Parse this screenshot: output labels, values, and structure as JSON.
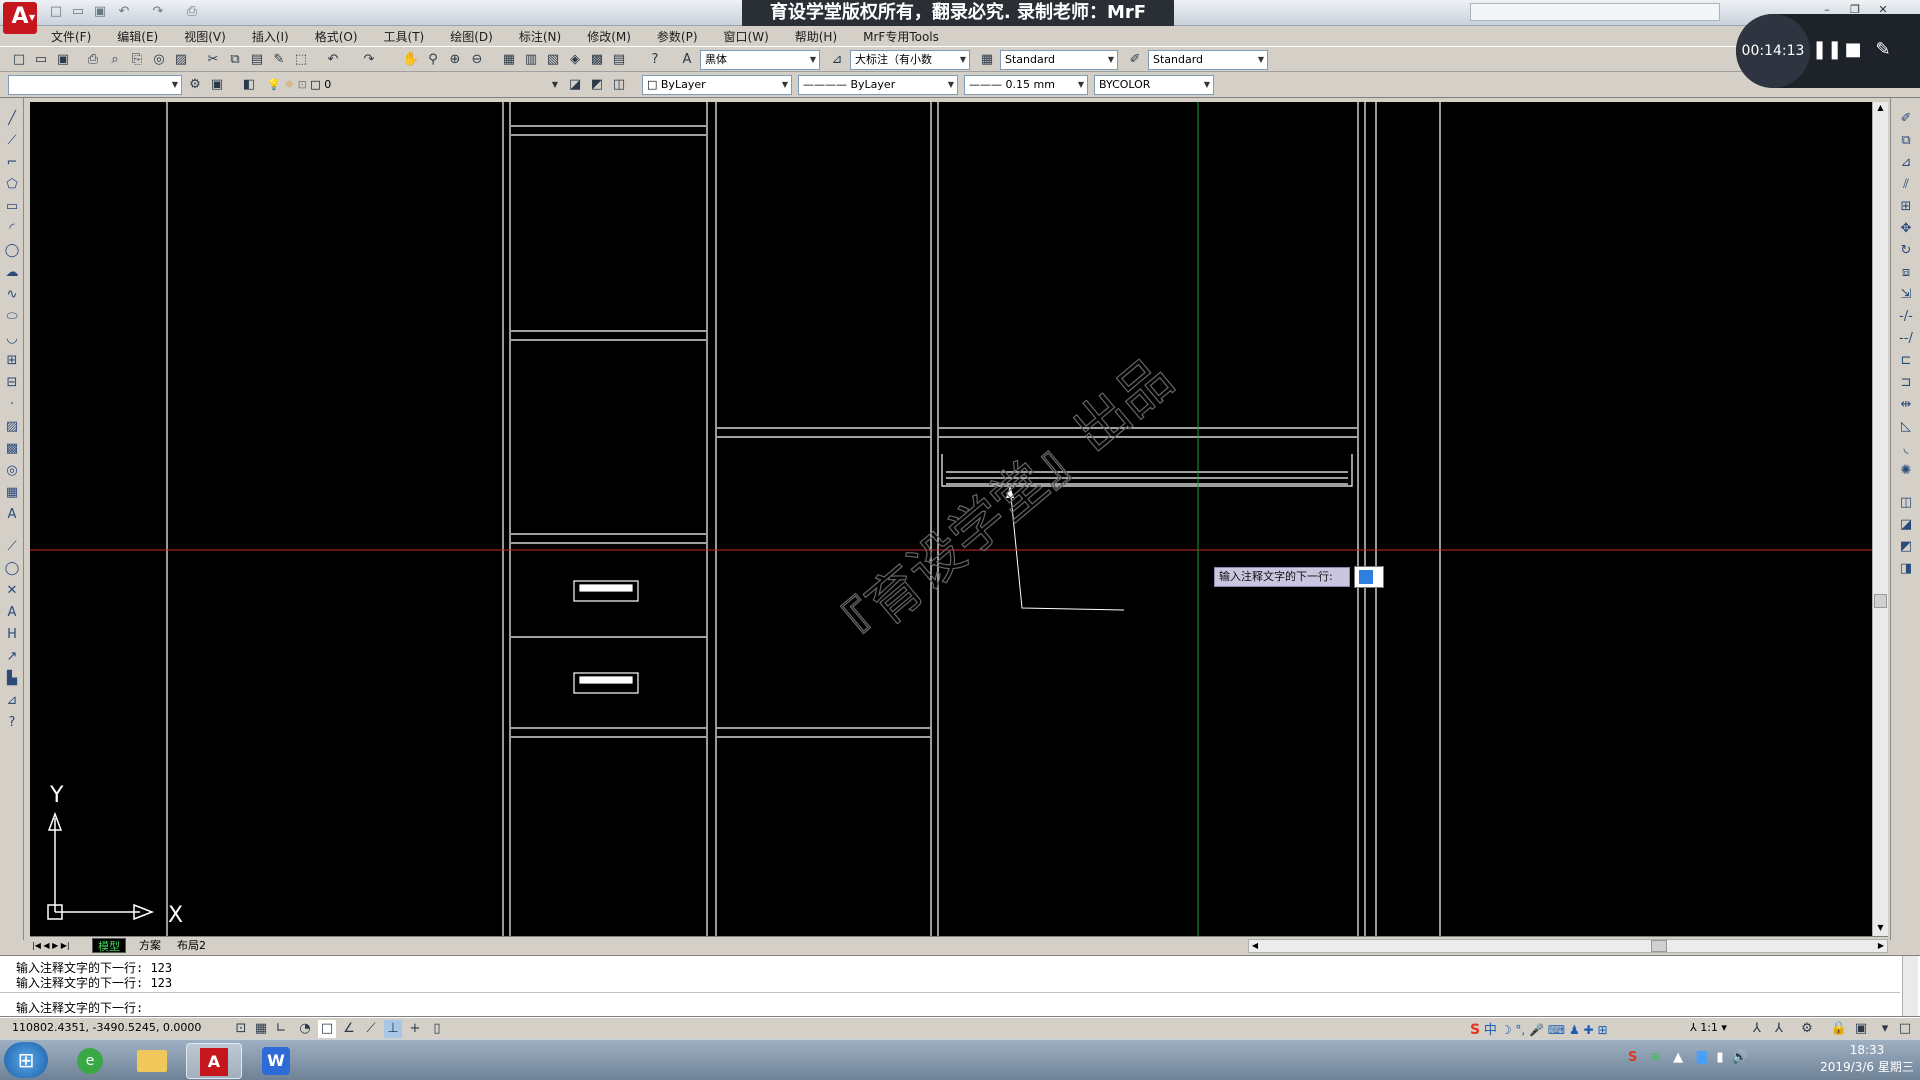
{
  "window": {
    "title": "育设学堂版权所有，翻录必究. 录制老师：MrF",
    "logo_text": "A"
  },
  "menu": [
    "文件(F)",
    "编辑(E)",
    "视图(V)",
    "插入(I)",
    "格式(O)",
    "工具(T)",
    "绘图(D)",
    "标注(N)",
    "修改(M)",
    "参数(P)",
    "窗口(W)",
    "帮助(H)",
    "MrF专用Tools"
  ],
  "toolbar1": {
    "font_combo": "黑体",
    "dim_style_combo": "大标注（有小数",
    "text_style_combo": "Standard",
    "table_style_combo": "Standard"
  },
  "toolbar2": {
    "layer_value": "0",
    "color_combo": "ByLayer",
    "linetype_combo": "ByLayer",
    "lineweight_combo": "0.15 mm",
    "plotstyle_combo": "BYCOLOR"
  },
  "recorder": {
    "time": "00:14:13"
  },
  "canvas": {
    "watermark": "『育设学堂』出品",
    "ucs_y": "Y",
    "ucs_x": "X",
    "dynamic_prompt": "输入注释文字的下一行:"
  },
  "tabs": [
    "模型",
    "方案",
    "布局2"
  ],
  "command": {
    "lines": [
      "输入注释文字的下一行: 123",
      "输入注释文字的下一行: 123"
    ],
    "prompt": "输入注释文字的下一行:"
  },
  "status": {
    "coordinates": "110802.4351, -3490.5245, 0.0000",
    "annotation_scale": "1:1"
  },
  "taskbar": {
    "time": "18:33",
    "date": "2019/3/6 星期三"
  },
  "colors": {
    "canvas_bg": "#000000",
    "linework": "#ffffff",
    "crosshair_horizontal": "#cc2a2a",
    "crosshair_vertical": "#1e9a3a",
    "title_bg": "#2a2f36"
  }
}
